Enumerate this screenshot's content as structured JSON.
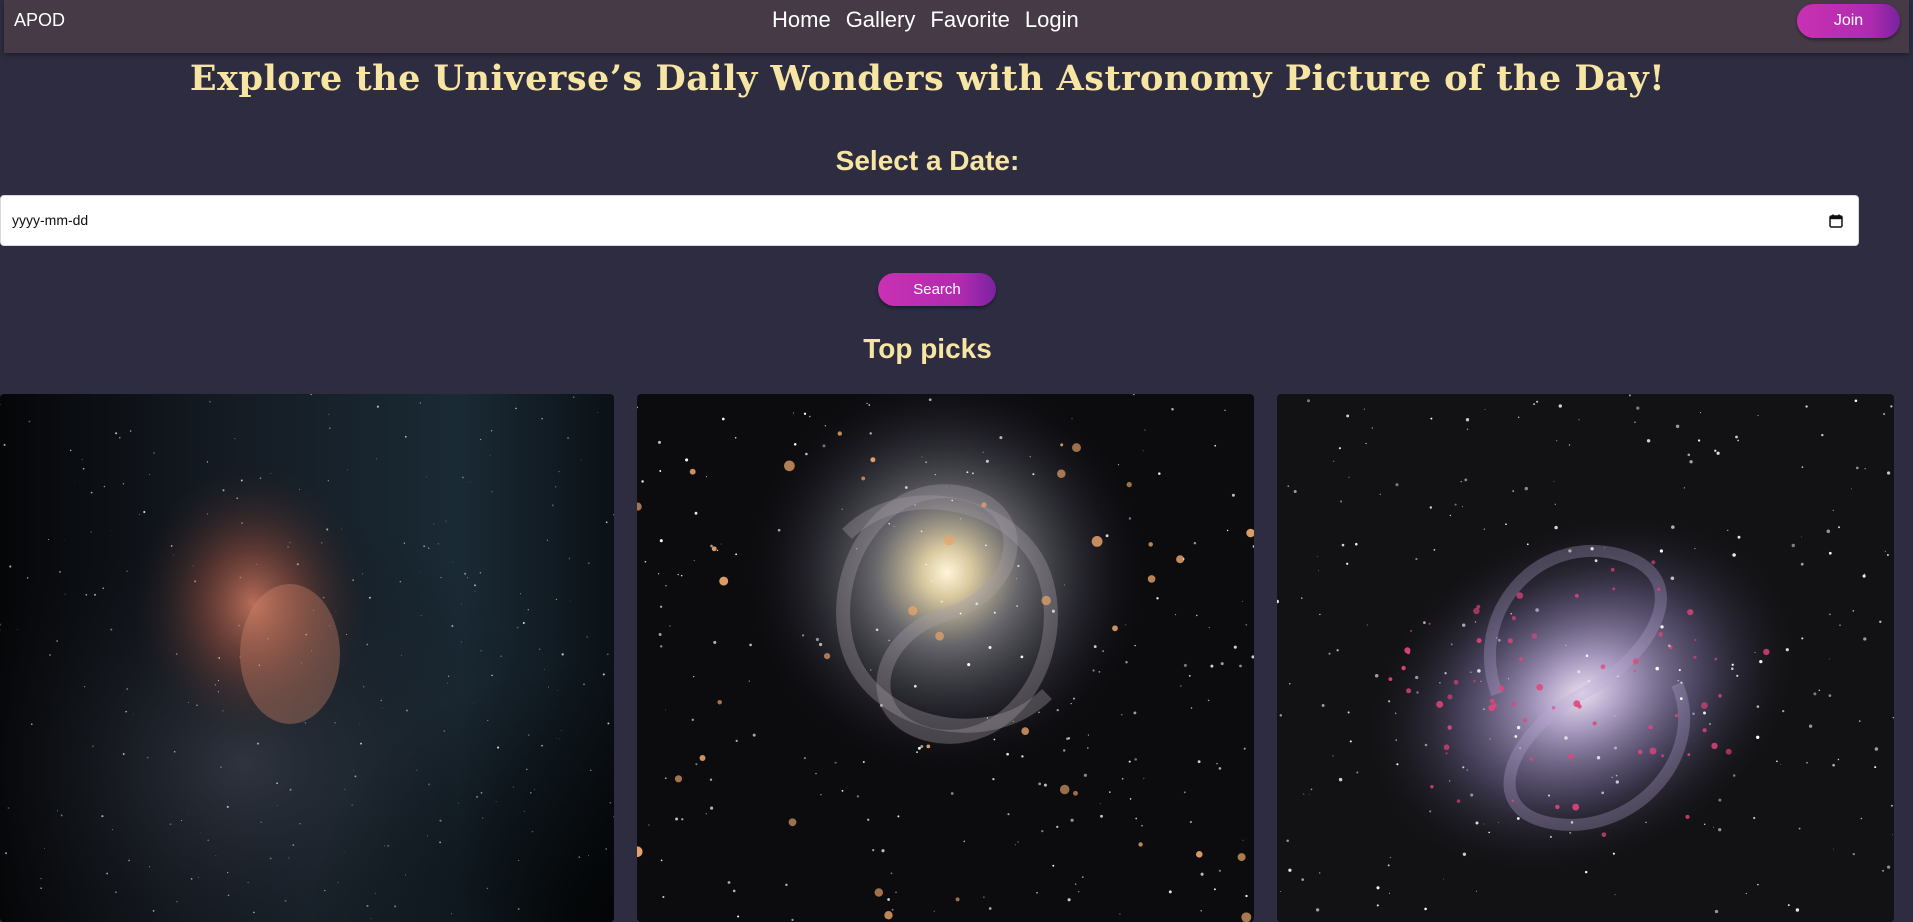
{
  "nav": {
    "brand": "APOD",
    "links": [
      "Home",
      "Gallery",
      "Favorite",
      "Login"
    ],
    "join_label": "Join"
  },
  "hero": {
    "title": "Explore the Universe’s Daily Wonders with Astronomy Picture of the Day!"
  },
  "search": {
    "label": "Select a Date:",
    "date_placeholder": "yyyy-mm-dd",
    "button_label": "Search"
  },
  "top_picks": {
    "title": "Top picks",
    "cards": [
      {
        "subject": "milky-way-nebula-image"
      },
      {
        "subject": "spiral-galaxy-image"
      },
      {
        "subject": "triangulum-galaxy-image"
      }
    ]
  },
  "colors": {
    "background": "#2e2c40",
    "navbar": "#463a47",
    "accent_text": "#f7e5a3",
    "button_gradient_start": "#c931b2",
    "button_gradient_end": "#7a22a0"
  }
}
